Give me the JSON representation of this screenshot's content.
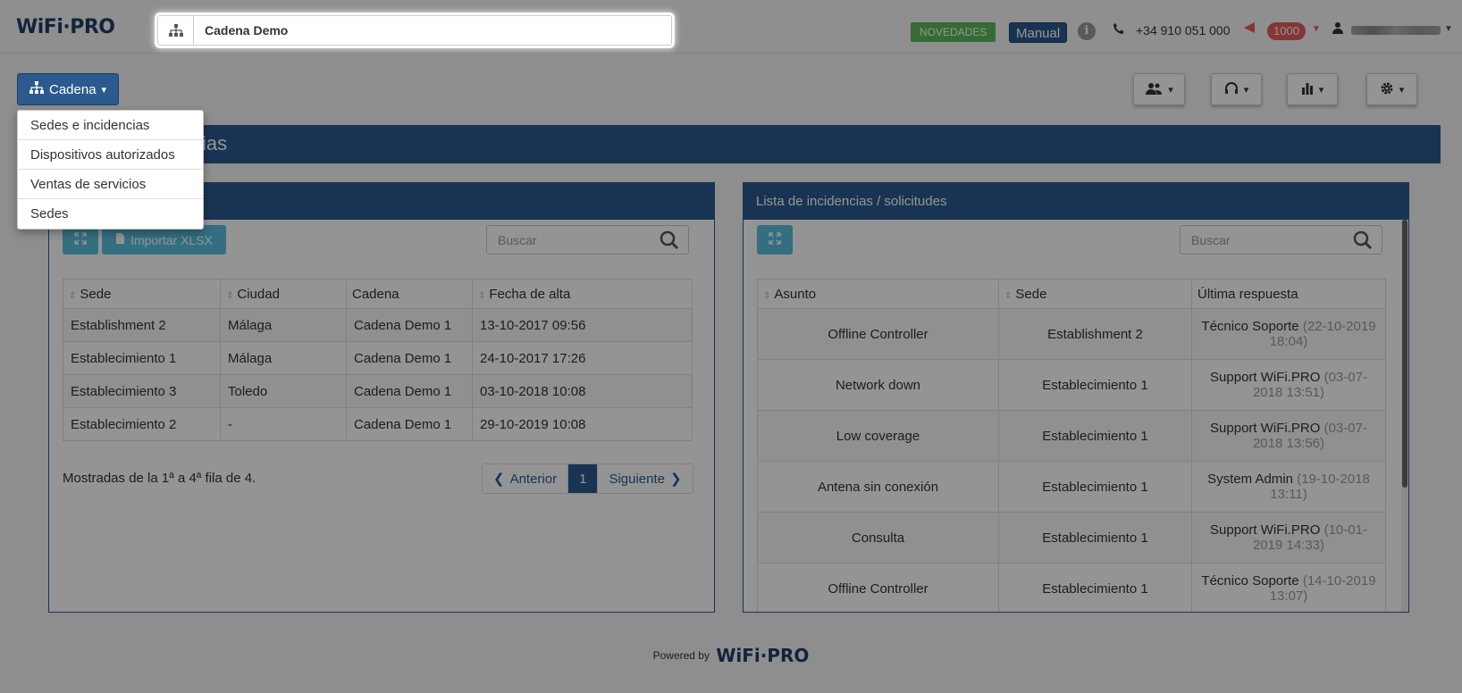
{
  "header": {
    "logo_text": "WiFi·PRO",
    "chain_value": "Cadena Demo",
    "news_label": "NOVEDADES",
    "manual_label": "Manual",
    "info_glyph": "i",
    "phone": "+34 910 051 000",
    "credits": "1000"
  },
  "toolbar": {
    "cadena_label": "Cadena",
    "caret": "▾"
  },
  "dropdown": {
    "items": [
      "Sedes e incidencias",
      "Dispositivos autorizados",
      "Ventas de servicios",
      "Sedes"
    ]
  },
  "page": {
    "title_visible": "ias"
  },
  "left_panel": {
    "import_label": "Importar XLSX",
    "search_placeholder": "Buscar",
    "columns": [
      "Sede",
      "Ciudad",
      "Cadena",
      "Fecha de alta"
    ],
    "rows": [
      [
        "Establishment 2",
        "Málaga",
        "Cadena Demo 1",
        "13-10-2017 09:56"
      ],
      [
        "Establecimiento 1",
        "Málaga",
        "Cadena Demo 1",
        "24-10-2017 17:26"
      ],
      [
        "Establecimiento 3",
        "Toledo",
        "Cadena Demo 1",
        "03-10-2018 10:08"
      ],
      [
        "Establecimiento 2",
        "-",
        "Cadena Demo 1",
        "29-10-2019 10:08"
      ]
    ],
    "info": "Mostradas de la 1ª a 4ª fila de 4.",
    "pager": {
      "prev": "Anterior",
      "page": "1",
      "next": "Siguiente"
    }
  },
  "right_panel": {
    "title": "Lista de incidencias / solicitudes",
    "search_placeholder": "Buscar",
    "columns": [
      "Asunto",
      "Sede",
      "Última respuesta"
    ],
    "rows": [
      {
        "asunto": "Offline Controller",
        "sede": "Establishment 2",
        "who": "Técnico Soporte",
        "when": "(22-10-2019 18:04)"
      },
      {
        "asunto": "Network down",
        "sede": "Establecimiento 1",
        "who": "Support WiFi.PRO",
        "when": "(03-07-2018 13:51)"
      },
      {
        "asunto": "Low coverage",
        "sede": "Establecimiento 1",
        "who": "Support WiFi.PRO",
        "when": "(03-07-2018 13:56)"
      },
      {
        "asunto": "Antena sin conexión",
        "sede": "Establecimiento 1",
        "who": "System Admin",
        "when": "(19-10-2018 13:11)"
      },
      {
        "asunto": "Consulta",
        "sede": "Establecimiento 1",
        "who": "Support WiFi.PRO",
        "when": "(10-01-2019 14:33)"
      },
      {
        "asunto": "Offline Controller",
        "sede": "Establecimiento 1",
        "who": "Técnico Soporte",
        "when": "(14-10-2019 13:07)"
      }
    ]
  },
  "footer": {
    "powered_by": "Powered by",
    "brand": "WiFi·PRO"
  },
  "colors": {
    "brand_blue": "#2b5a8f",
    "info_cyan": "#5bc0de",
    "news_green": "#5cb85c",
    "alert_red": "#e45c5c"
  }
}
